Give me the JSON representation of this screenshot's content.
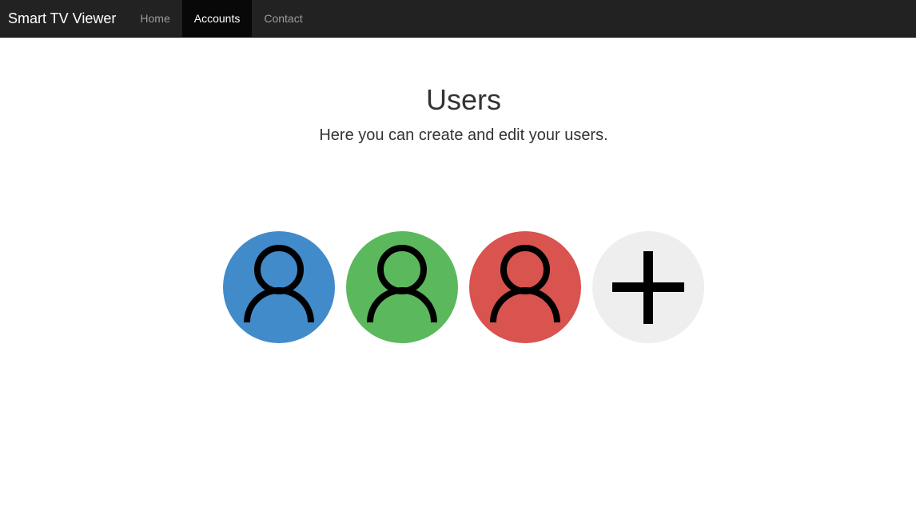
{
  "navbar": {
    "brand": "Smart TV Viewer",
    "items": [
      {
        "label": "Home",
        "active": false
      },
      {
        "label": "Accounts",
        "active": true
      },
      {
        "label": "Contact",
        "active": false
      }
    ]
  },
  "main": {
    "title": "Users",
    "subtitle": "Here you can create and edit your users."
  },
  "users": [
    {
      "icon": "user-icon",
      "color": "#428bca"
    },
    {
      "icon": "user-icon",
      "color": "#5cb85c"
    },
    {
      "icon": "user-icon",
      "color": "#d9534f"
    }
  ],
  "add_user": {
    "icon": "plus-icon",
    "color": "#eeeeee"
  }
}
